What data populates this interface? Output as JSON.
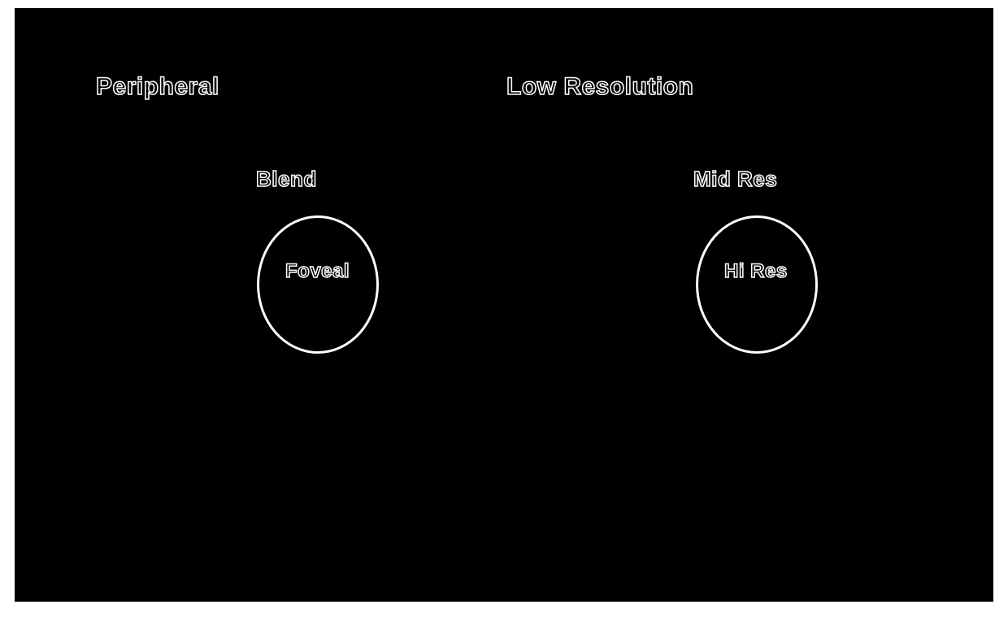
{
  "left": {
    "outer": "Peripheral",
    "mid": "Blend",
    "inner": "Foveal"
  },
  "right": {
    "outer": "Low Resolution",
    "mid": "Mid Res",
    "inner": "Hi Res"
  }
}
